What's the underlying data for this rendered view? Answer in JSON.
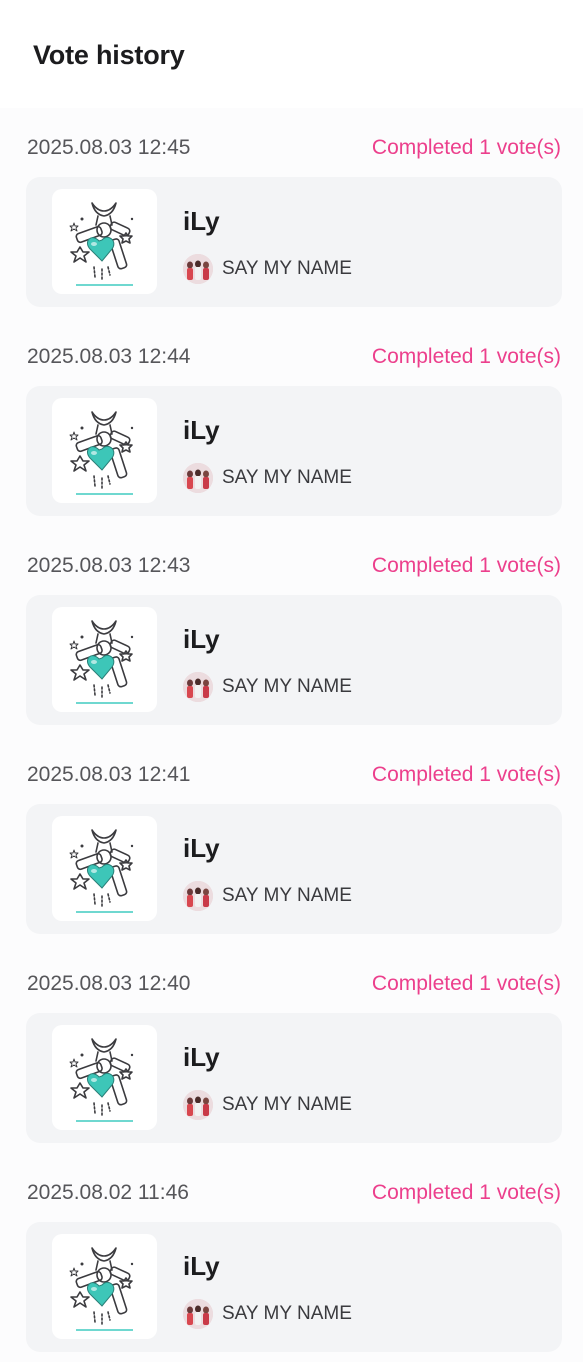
{
  "header": {
    "title": "Vote history"
  },
  "entries": [
    {
      "date": "2025.08.03 12:45",
      "status": "Completed 1 vote(s)",
      "artist": "iLy",
      "song": "SAY MY NAME"
    },
    {
      "date": "2025.08.03 12:44",
      "status": "Completed 1 vote(s)",
      "artist": "iLy",
      "song": "SAY MY NAME"
    },
    {
      "date": "2025.08.03 12:43",
      "status": "Completed 1 vote(s)",
      "artist": "iLy",
      "song": "SAY MY NAME"
    },
    {
      "date": "2025.08.03 12:41",
      "status": "Completed 1 vote(s)",
      "artist": "iLy",
      "song": "SAY MY NAME"
    },
    {
      "date": "2025.08.03 12:40",
      "status": "Completed 1 vote(s)",
      "artist": "iLy",
      "song": "SAY MY NAME"
    },
    {
      "date": "2025.08.02 11:46",
      "status": "Completed 1 vote(s)",
      "artist": "iLy",
      "song": "SAY MY NAME"
    }
  ],
  "colors": {
    "accent": "#ec3f8c",
    "card_background": "#f3f4f6",
    "heart_teal": "#3dc6b8"
  },
  "icons": {
    "album_art": "album-cover-icon",
    "song_avatar": "group-avatar-icon"
  }
}
